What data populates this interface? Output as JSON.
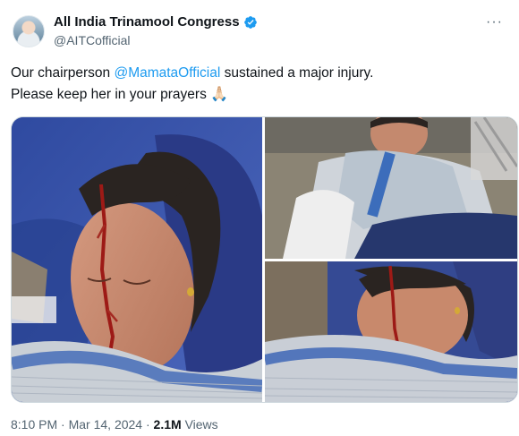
{
  "author": {
    "display_name": "All India Trinamool Congress",
    "handle": "@AITCofficial",
    "verified_icon": "verified-badge-icon"
  },
  "more_icon": "more-options-icon",
  "tweet": {
    "line1_prefix": "Our chairperson ",
    "mention": "@MamataOfficial",
    "line1_suffix": " sustained a major injury.",
    "line2": "Please keep her in your prayers ",
    "emoji": "🙏🏻"
  },
  "media": {
    "count": 3
  },
  "meta": {
    "time": "8:10 PM",
    "separator": "·",
    "date": "Mar 14, 2024",
    "views_count": "2.1M",
    "views_label": "Views"
  },
  "colors": {
    "accent": "#1d9bf0",
    "text": "#0f1419",
    "muted": "#536471"
  }
}
